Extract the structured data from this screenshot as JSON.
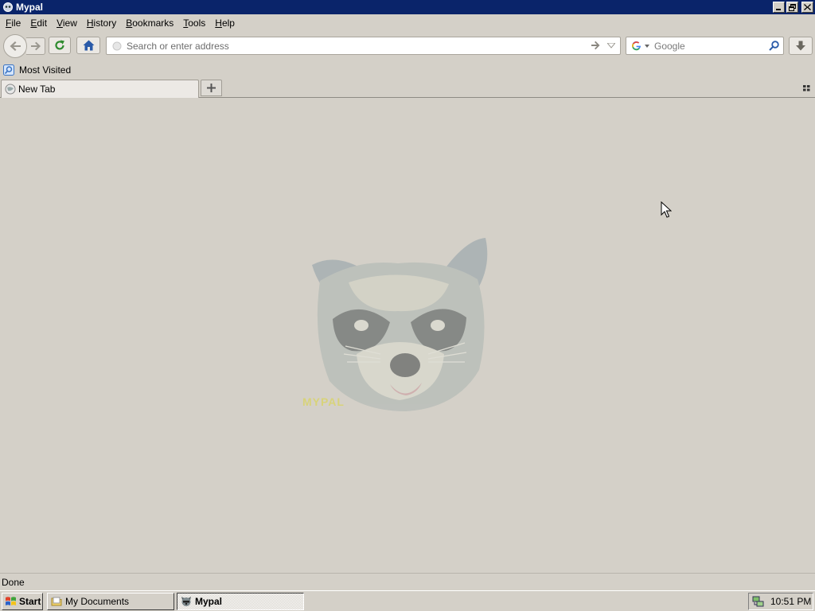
{
  "window": {
    "title": "Mypal"
  },
  "menu": [
    {
      "label": "File",
      "acc": "F",
      "rest": "ile"
    },
    {
      "label": "Edit",
      "acc": "E",
      "rest": "dit"
    },
    {
      "label": "View",
      "acc": "V",
      "rest": "iew"
    },
    {
      "label": "History",
      "acc": "H",
      "rest": "istory"
    },
    {
      "label": "Bookmarks",
      "acc": "B",
      "rest": "ookmarks"
    },
    {
      "label": "Tools",
      "acc": "T",
      "rest": "ools"
    },
    {
      "label": "Help",
      "acc": "H",
      "rest": "elp"
    }
  ],
  "navbar": {
    "address_placeholder": "Search or enter address",
    "address_value": "",
    "search_placeholder": "Google",
    "search_value": ""
  },
  "bookmarks": {
    "most_visited": "Most Visited"
  },
  "tabs": [
    {
      "label": "New Tab"
    }
  ],
  "content": {
    "logo_text": "MYPAL"
  },
  "status": {
    "text": "Done"
  },
  "taskbar": {
    "start_label": "Start",
    "tasks": [
      {
        "label": "My Documents"
      },
      {
        "label": "Mypal"
      }
    ],
    "clock": "10:51 PM"
  },
  "colors": {
    "titlebar": "#0a246a",
    "background": "#d4d0c8"
  }
}
